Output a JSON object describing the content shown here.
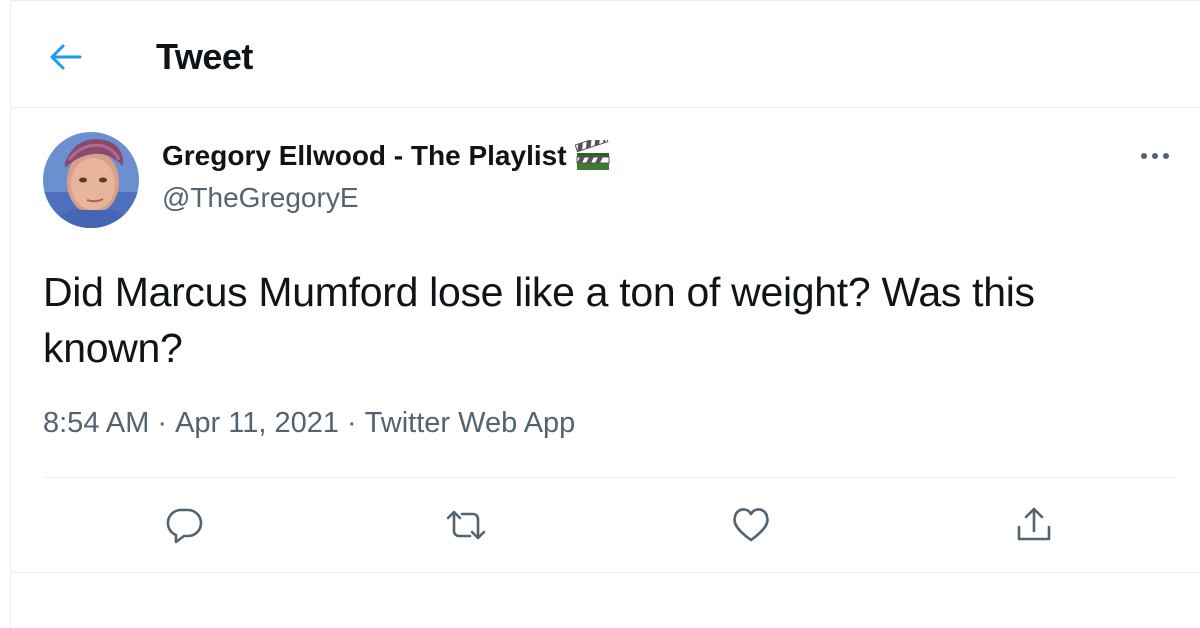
{
  "header": {
    "title": "Tweet",
    "back_icon": "arrow-left-icon",
    "accent_color": "#1d9bf0"
  },
  "tweet": {
    "author_name": "Gregory Ellwood - The Playlist",
    "author_emoji_icon": "clapper-board-icon",
    "handle": "@TheGregoryE",
    "text": "Did Marcus Mumford lose like a ton of weight? Was this known?",
    "time": "8:54 AM",
    "date": "Apr 11, 2021",
    "source": "Twitter Web App",
    "separator": "·"
  },
  "actions": [
    {
      "name": "reply",
      "icon": "reply-icon"
    },
    {
      "name": "retweet",
      "icon": "retweet-icon"
    },
    {
      "name": "like",
      "icon": "heart-icon"
    },
    {
      "name": "share",
      "icon": "share-icon"
    }
  ],
  "colors": {
    "text_primary": "#0f1419",
    "text_secondary": "#536471",
    "border": "#eaeef1"
  }
}
